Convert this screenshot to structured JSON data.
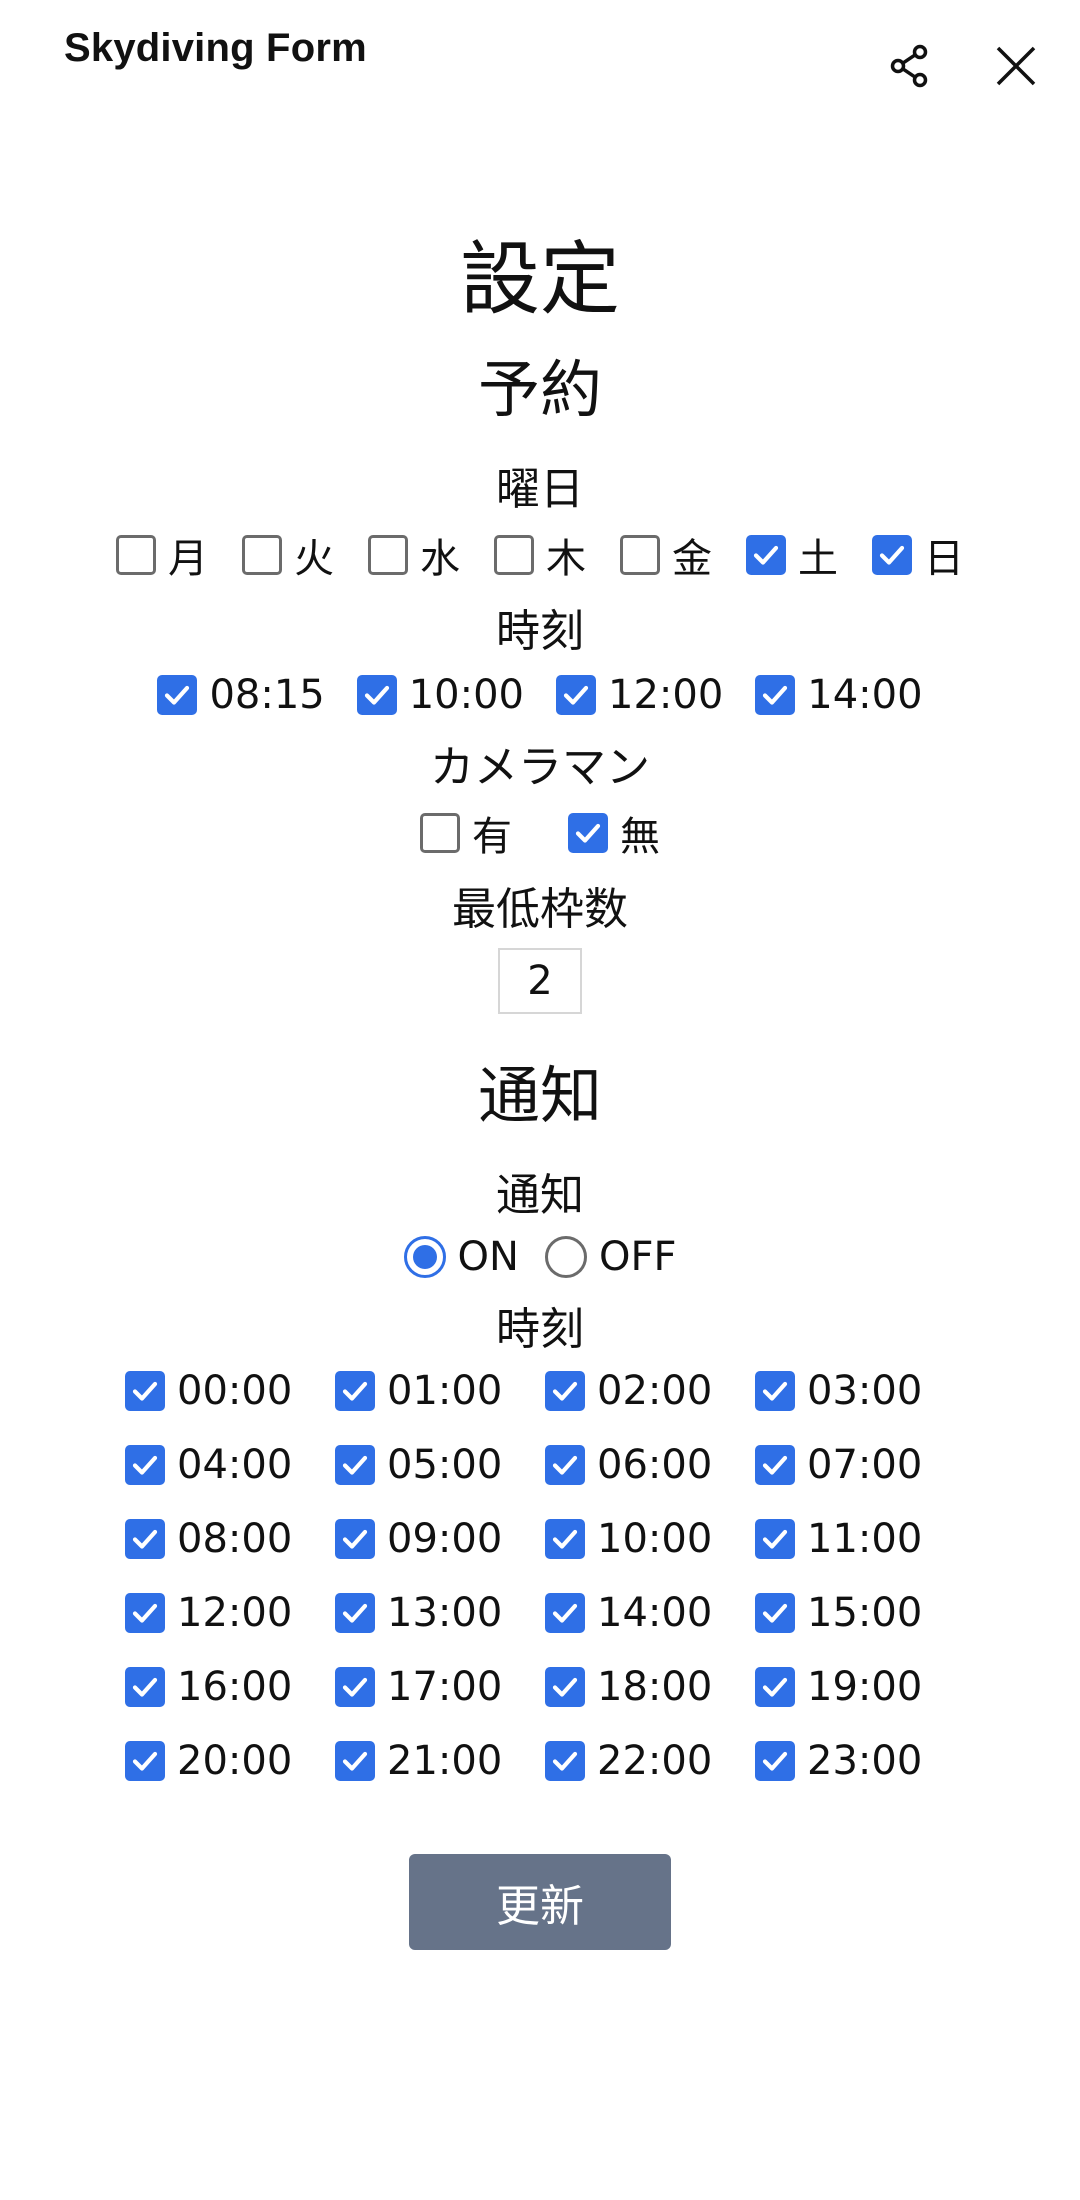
{
  "app": {
    "title": "Skydiving Form"
  },
  "icons": {
    "share": "share-icon",
    "close": "close-icon"
  },
  "colors": {
    "accent": "#2f6fe6",
    "button": "#667389"
  },
  "settings_title": "設定",
  "reservation": {
    "heading": "予約",
    "weekdays_label": "曜日",
    "weekdays": [
      {
        "label": "月",
        "checked": false
      },
      {
        "label": "火",
        "checked": false
      },
      {
        "label": "水",
        "checked": false
      },
      {
        "label": "木",
        "checked": false
      },
      {
        "label": "金",
        "checked": false
      },
      {
        "label": "土",
        "checked": true
      },
      {
        "label": "日",
        "checked": true
      }
    ],
    "times_label": "時刻",
    "times": [
      {
        "label": "08:15",
        "checked": true
      },
      {
        "label": "10:00",
        "checked": true
      },
      {
        "label": "12:00",
        "checked": true
      },
      {
        "label": "14:00",
        "checked": true
      }
    ],
    "cameraman_label": "カメラマン",
    "cameraman": [
      {
        "label": "有",
        "checked": false
      },
      {
        "label": "無",
        "checked": true
      }
    ],
    "min_slots_label": "最低枠数",
    "min_slots_value": "2"
  },
  "notification": {
    "heading": "通知",
    "toggle_label": "通知",
    "options": [
      {
        "label": "ON",
        "selected": true
      },
      {
        "label": "OFF",
        "selected": false
      }
    ],
    "times_label": "時刻",
    "hours": [
      {
        "label": "00:00",
        "checked": true
      },
      {
        "label": "01:00",
        "checked": true
      },
      {
        "label": "02:00",
        "checked": true
      },
      {
        "label": "03:00",
        "checked": true
      },
      {
        "label": "04:00",
        "checked": true
      },
      {
        "label": "05:00",
        "checked": true
      },
      {
        "label": "06:00",
        "checked": true
      },
      {
        "label": "07:00",
        "checked": true
      },
      {
        "label": "08:00",
        "checked": true
      },
      {
        "label": "09:00",
        "checked": true
      },
      {
        "label": "10:00",
        "checked": true
      },
      {
        "label": "11:00",
        "checked": true
      },
      {
        "label": "12:00",
        "checked": true
      },
      {
        "label": "13:00",
        "checked": true
      },
      {
        "label": "14:00",
        "checked": true
      },
      {
        "label": "15:00",
        "checked": true
      },
      {
        "label": "16:00",
        "checked": true
      },
      {
        "label": "17:00",
        "checked": true
      },
      {
        "label": "18:00",
        "checked": true
      },
      {
        "label": "19:00",
        "checked": true
      },
      {
        "label": "20:00",
        "checked": true
      },
      {
        "label": "21:00",
        "checked": true
      },
      {
        "label": "22:00",
        "checked": true
      },
      {
        "label": "23:00",
        "checked": true
      }
    ]
  },
  "update_button": "更新"
}
